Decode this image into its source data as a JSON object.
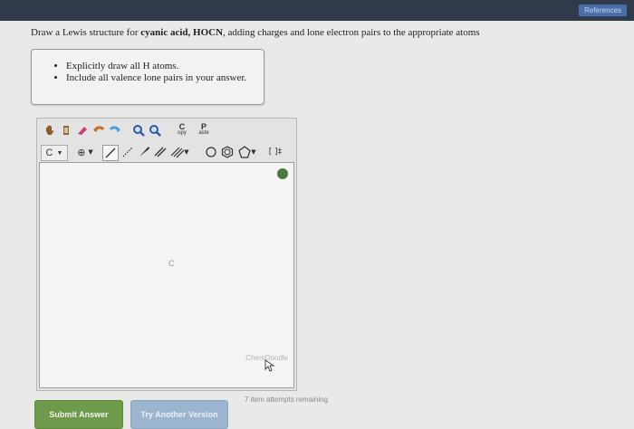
{
  "header": {
    "references_label": "References"
  },
  "question": {
    "prefix": "Draw a Lewis structure for ",
    "compound_name": "cyanic acid, HOCN",
    "suffix": ", adding charges and lone electron pairs to the appropriate atoms"
  },
  "hints": [
    "Explicitly draw all H atoms.",
    "Include all valence lone pairs in your answer."
  ],
  "toolbar": {
    "copy_label_top": "C",
    "copy_label_bottom": "opy",
    "paste_label_top": "P",
    "paste_label_bottom": "aste",
    "element_selector": "C",
    "charge_selector": "⊕",
    "bracket_label": "[ ]‡"
  },
  "canvas": {
    "atom_label": "C",
    "brand": "ChemDoodle"
  },
  "actions": {
    "submit_label": "Submit Answer",
    "try_label": "Try Another Version",
    "attempts_text": "7 item attempts remaining"
  },
  "colors": {
    "submit_green": "#6f9a4b",
    "try_blue": "#9bb5cf",
    "topbar": "#2f3a4a"
  }
}
